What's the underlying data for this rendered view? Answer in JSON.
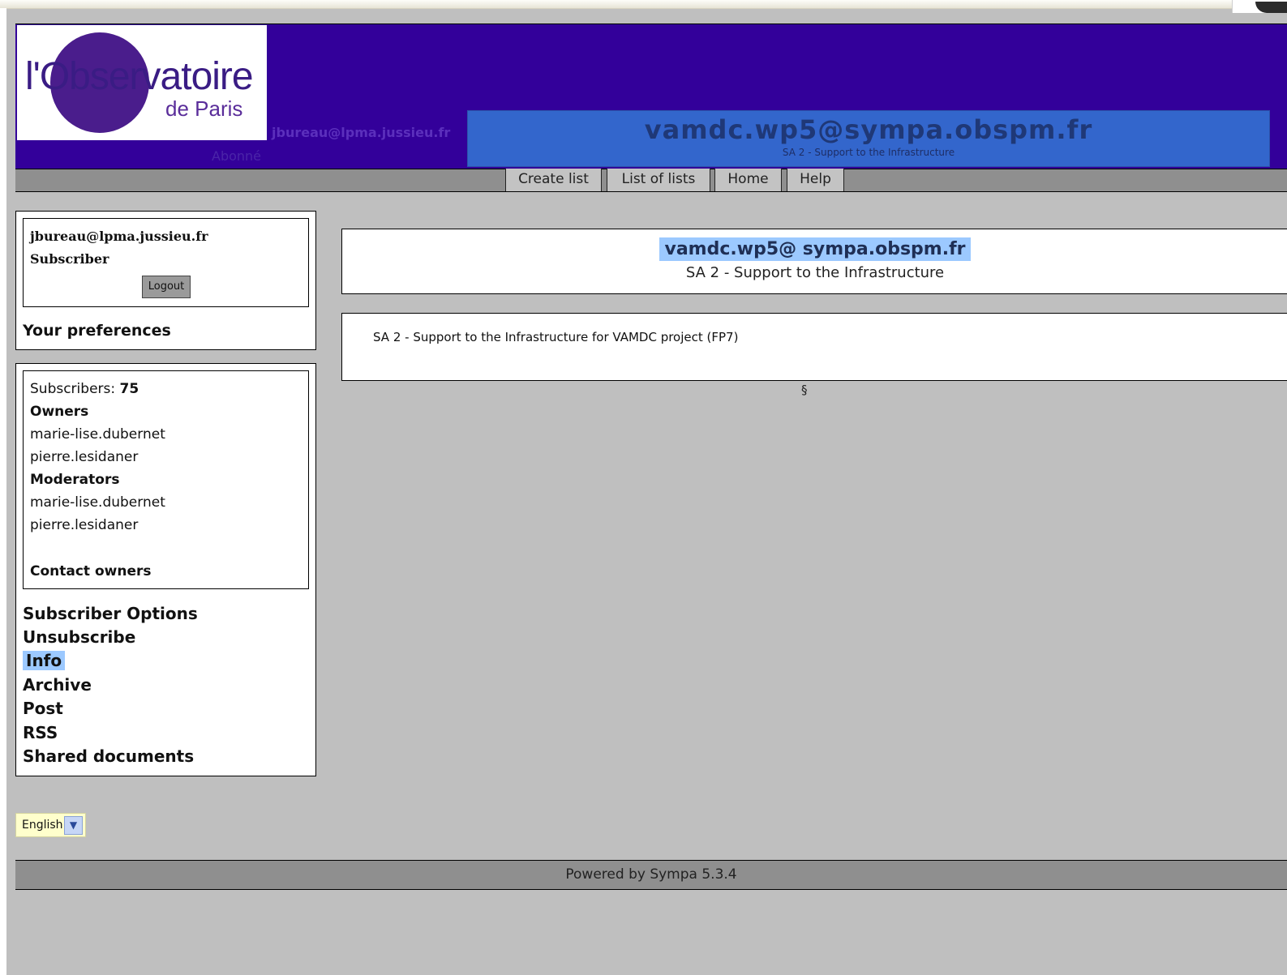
{
  "header": {
    "logo_main": "l'Observatoire",
    "logo_sub": "de Paris",
    "user_email": "jbureau@lpma.jussieu.fr",
    "user_role": "Abonné",
    "list_address": "vamdc.wp5@sympa.obspm.fr",
    "list_subject": "SA 2 - Support to the Infrastructure"
  },
  "menu": {
    "items": [
      "Create list",
      "List of lists",
      "Home",
      "Help"
    ]
  },
  "sidebar": {
    "login": {
      "email": "jbureau@lpma.jussieu.fr",
      "role": "Subscriber",
      "logout_label": "Logout"
    },
    "preferences_label": "Your preferences",
    "info": {
      "subscribers_label": "Subscribers:",
      "subscribers_count": "75",
      "owners_heading": "Owners",
      "owners": [
        "marie-lise.dubernet",
        "pierre.lesidaner"
      ],
      "moderators_heading": "Moderators",
      "moderators": [
        "marie-lise.dubernet",
        "pierre.lesidaner"
      ],
      "contact_label": "Contact owners"
    },
    "nav": [
      "Subscriber Options",
      "Unsubscribe",
      "Info",
      "Archive",
      "Post",
      "RSS",
      "Shared documents"
    ],
    "active_nav": "Info"
  },
  "main": {
    "list_address": "vamdc.wp5@ sympa.obspm.fr",
    "list_subject": "SA 2 - Support to the Infrastructure",
    "description": "SA 2 - Support to the Infrastructure for VAMDC project (FP7)",
    "section_mark": "§"
  },
  "language": {
    "selected": "English"
  },
  "footer": {
    "text": "Powered by Sympa 5.3.4"
  },
  "colors": {
    "header_bg": "#33009a",
    "title_band": "#3366cc",
    "highlight": "#9cc9ff",
    "page_bg": "#bfbfbf"
  }
}
